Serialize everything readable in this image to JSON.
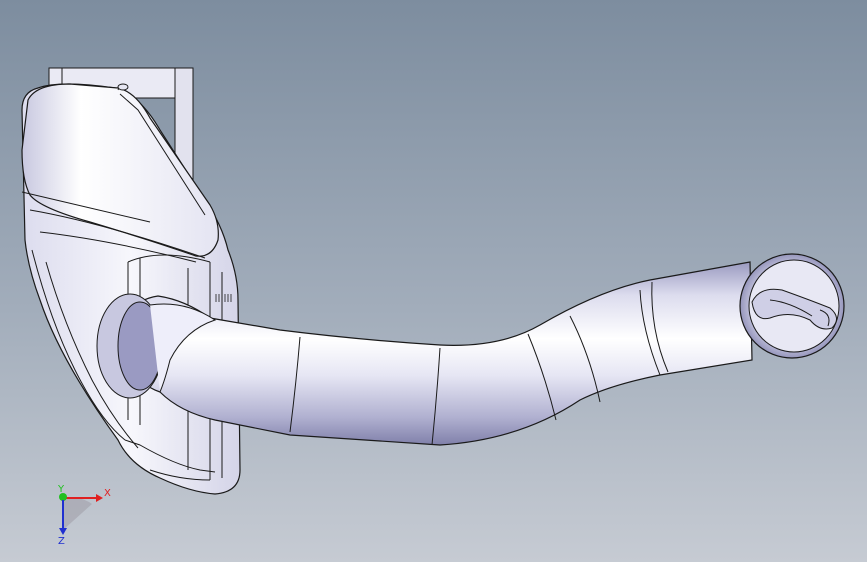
{
  "viewport": {
    "background_top": "#7d8d9f",
    "background_bottom": "#c6cbd3",
    "model": {
      "shade_light": "#ffffff",
      "shade_mid": "#d9d9ec",
      "shade_dark": "#8c8cb2",
      "edge_color": "#1a1a1a"
    }
  },
  "triad": {
    "x_label": "X",
    "y_label": "Y",
    "z_label": "Z",
    "x_color": "#e02020",
    "y_color": "#20c020",
    "z_color": "#2030d0"
  }
}
